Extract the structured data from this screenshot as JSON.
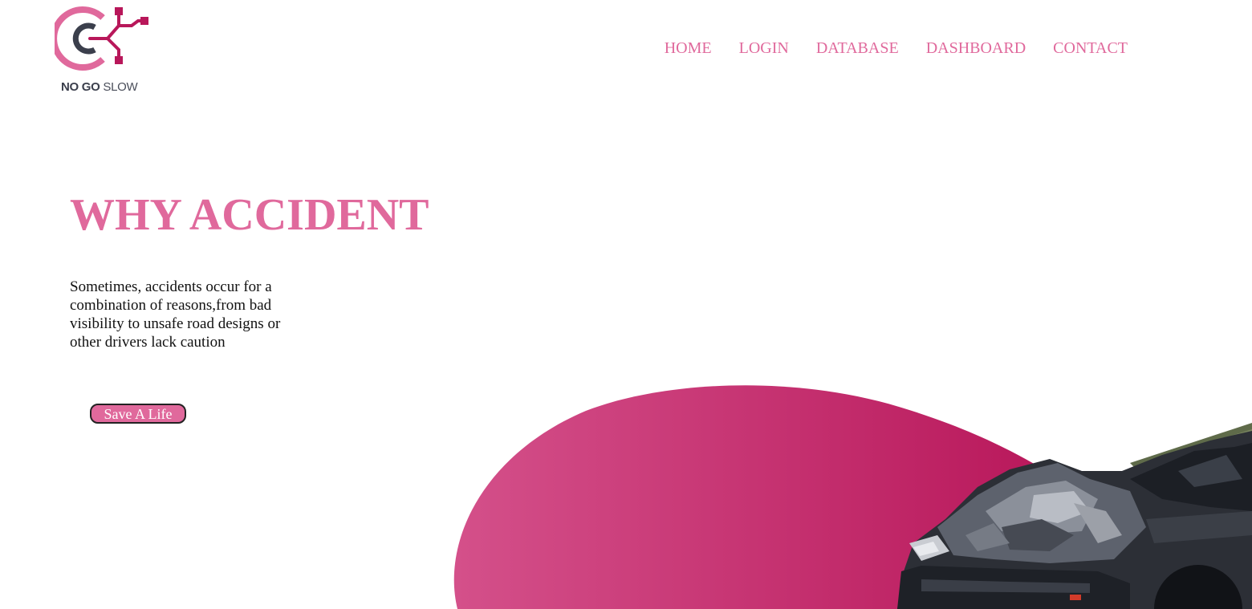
{
  "brand": {
    "logo_bold": "NO GO",
    "logo_light": "SLOW",
    "accent_color": "#e0699c",
    "dark_color": "#3b3f4c"
  },
  "nav": {
    "items": [
      {
        "label": "HOME"
      },
      {
        "label": "LOGIN"
      },
      {
        "label": "DATABASE"
      },
      {
        "label": "DASHBOARD"
      },
      {
        "label": "CONTACT"
      }
    ]
  },
  "hero": {
    "title": "WHY ACCIDENT",
    "text": "Sometimes, accidents occur for a combination of reasons,from bad visibility to unsafe road designs or other drivers lack caution",
    "cta_label": "Save A Life"
  },
  "graphics": {
    "blob_gradient": [
      "#d4508a",
      "#b8175a"
    ],
    "image": "wrecked-car-image"
  }
}
